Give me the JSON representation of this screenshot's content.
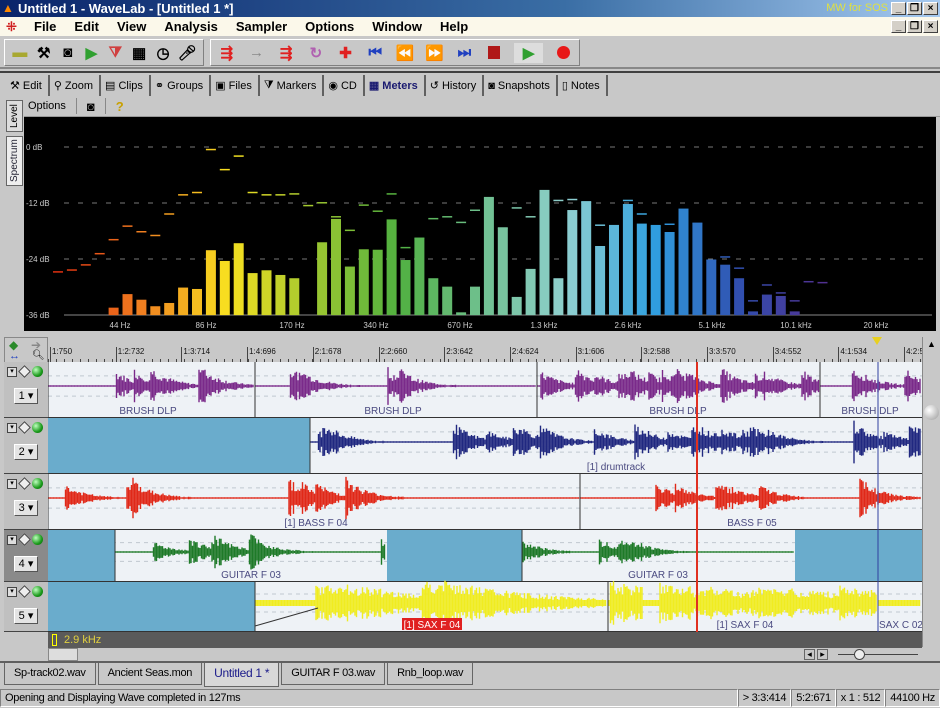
{
  "window": {
    "title": "Untitled 1 - WaveLab - [Untitled 1 *]",
    "brand": "MW for SOS",
    "controls": [
      "_",
      "❐",
      "×"
    ]
  },
  "menu": [
    "File",
    "Edit",
    "View",
    "Analysis",
    "Sampler",
    "Options",
    "Window",
    "Help"
  ],
  "toolbar": {
    "left_icons": [
      "ruler-icon",
      "hammer-icon",
      "camera-icon",
      "play-green-icon",
      "markers-icon",
      "meters-icon",
      "stopwatch-icon",
      "microphone-icon"
    ],
    "transport_icons": [
      "loop-start-icon",
      "arrow-icon",
      "loop-end-icon",
      "cycle-icon",
      "punch-icon",
      "go-start-icon",
      "rewind-icon",
      "fast-forward-icon",
      "go-end-icon",
      "stop-icon",
      "play-icon",
      "record-icon"
    ],
    "colors": {
      "stop": "#b01818",
      "play": "#30a030",
      "record": "#e81818"
    }
  },
  "tabs": [
    {
      "label": "Edit",
      "icon": "hammer-icon"
    },
    {
      "label": "Zoom",
      "icon": "magnifier-icon"
    },
    {
      "label": "Clips",
      "icon": "clips-icon"
    },
    {
      "label": "Groups",
      "icon": "groups-icon"
    },
    {
      "label": "Files",
      "icon": "files-icon"
    },
    {
      "label": "Markers",
      "icon": "markers-icon"
    },
    {
      "label": "CD",
      "icon": "cd-icon"
    },
    {
      "label": "Meters",
      "icon": "meters-icon",
      "active": true
    },
    {
      "label": "History",
      "icon": "history-icon"
    },
    {
      "label": "Snapshots",
      "icon": "camera-icon"
    },
    {
      "label": "Notes",
      "icon": "notes-icon"
    }
  ],
  "meters_panel": {
    "options_label": "Options",
    "help_glyph": "?",
    "vertical_tabs": [
      "Level",
      "Spectrum"
    ],
    "active_vertical_tab": "Spectrum"
  },
  "chart_data": {
    "type": "bar",
    "title": "",
    "xlabel": "",
    "ylabel": "",
    "y_ticks": [
      "0 dB",
      "-12 dB",
      "-24 dB",
      "-36 dB"
    ],
    "ylim": [
      -36,
      0
    ],
    "x_ticks": [
      "44 Hz",
      "86 Hz",
      "170 Hz",
      "340 Hz",
      "670 Hz",
      "1.3 kHz",
      "2.6 kHz",
      "5.1 kHz",
      "10.1 kHz",
      "20 kHz"
    ],
    "grid": true,
    "values_db": [
      -36,
      -36,
      -36,
      -36,
      -34.4,
      -31.5,
      -32.7,
      -34.1,
      -33.4,
      -30.1,
      -30.4,
      -22.1,
      -24.4,
      -20.6,
      -27.0,
      -26.4,
      -27.4,
      -28.1,
      -36,
      -20.4,
      -15.4,
      -25.6,
      -21.9,
      -22.0,
      -15.5,
      -24.2,
      -19.6,
      -28.1,
      -29.9,
      -35.4,
      -29.9,
      -10.9,
      -17.4,
      -32.1,
      -26.1,
      -9.4,
      -28.1,
      -13.5,
      -11.8,
      -21.2,
      -16.9,
      -12.2,
      -16.4,
      -16.9,
      -18.2,
      -13.4,
      -16.4,
      -24.3,
      -25.2,
      -28.1,
      -35.2,
      -31.6,
      -31.9,
      -35.2,
      -36,
      -36
    ],
    "peaks_db": [
      -26.8,
      -26.4,
      -25.3,
      -22.9,
      -19.9,
      -17.0,
      -18.2,
      -19.0,
      -14.4,
      -10.3,
      -9.8,
      -0.6,
      -4.9,
      -2.0,
      -9.8,
      -10.3,
      -10.3,
      -10.1,
      -12.6,
      -12.0,
      -15.0,
      -17.9,
      -12.5,
      -13.8,
      -10.1,
      -21.6,
      -19.6,
      -15.4,
      -15.0,
      -16.2,
      -13.6,
      -10.9,
      -17.4,
      -13.1,
      -15.0,
      -9.4,
      -11.5,
      -11.3,
      -11.8,
      -16.8,
      -16.9,
      -11.5,
      -14.4,
      -16.9,
      -16.6,
      -13.4,
      -16.4,
      -24.3,
      -23.6,
      -26.0,
      -33.0,
      -29.6,
      -31.3,
      -33.0,
      -28.9,
      -29.1
    ],
    "color_stops": [
      "#e03010",
      "#f08020",
      "#f8e020",
      "#a0c830",
      "#50b040",
      "#70c090",
      "#90d0d0",
      "#30a0e0",
      "#3050b0",
      "#503090"
    ]
  },
  "ruler": {
    "labels": [
      "1:750",
      "1:2:732",
      "1:3:714",
      "1:4:696",
      "2:1:678",
      "2:2:660",
      "2:3:642",
      "2:4:624",
      "3:1:606",
      "3:2:588",
      "3:3:570",
      "3:4:552",
      "4:1:534",
      "4:2:5"
    ]
  },
  "tracks": [
    {
      "number": "1",
      "color": "#7a2a8a",
      "clips": [
        "BRUSH DLP",
        "BRUSH DLP",
        "BRUSH DLP",
        "BRUSH DLP"
      ]
    },
    {
      "number": "2",
      "color": "#202880",
      "clips": [
        "[1] drumtrack"
      ]
    },
    {
      "number": "3",
      "color": "#e02818",
      "clips": [
        "[1] BASS F 04",
        "BASS F 05"
      ]
    },
    {
      "number": "4",
      "color": "#1e7a28",
      "clips": [
        "GUITAR F 03",
        "GUITAR F 03"
      ]
    },
    {
      "number": "5",
      "color": "#f0ec20",
      "clips": [
        "[1] SAX F 04",
        "[1] SAX F 04",
        "SAX C 02"
      ]
    }
  ],
  "empty_region_color": "#6aaccc",
  "freq_readout": "2.9 kHz",
  "doc_tabs": [
    {
      "label": "Sp-track02.wav"
    },
    {
      "label": "Ancient Seas.mon"
    },
    {
      "label": "Untitled 1 *",
      "active": true
    },
    {
      "label": "GUITAR F 03.wav"
    },
    {
      "label": "Rnb_loop.wav"
    }
  ],
  "status": {
    "message": "Opening and Displaying Wave completed in 127ms",
    "cursor": "> 3:3:414",
    "length": "5:2:671",
    "zoom": "x 1 : 512",
    "rate": "44100 Hz"
  }
}
